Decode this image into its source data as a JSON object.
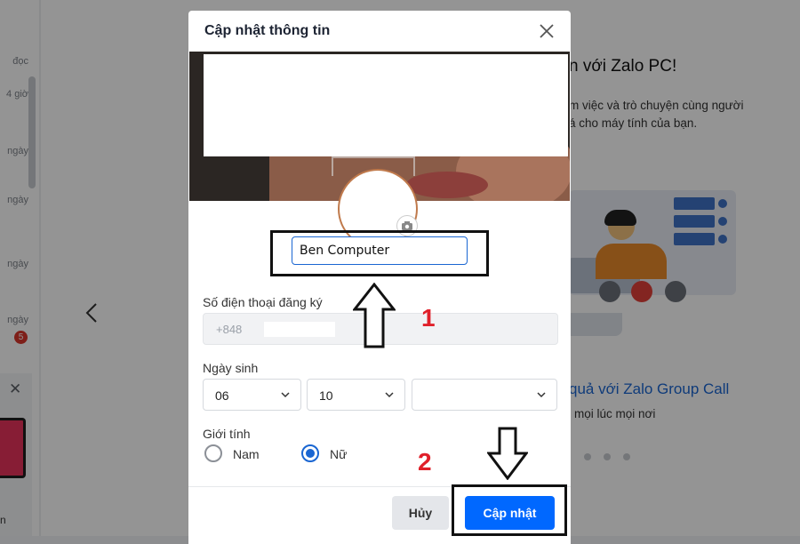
{
  "background": {
    "list_meta": [
      "đọc",
      "4 giờ",
      "ngày",
      "ngày",
      "ngày",
      "ngày"
    ],
    "unread_badge": "5",
    "welcome_title": "n với Zalo PC!",
    "welcome_desc": "m việc và trò chuyện cùng người\ná cho máy tính của bạn.",
    "feature_title": "quả với Zalo Group Call",
    "feature_desc": "mọi lúc mọi nơi",
    "notif_text": "n"
  },
  "modal": {
    "title": "Cập nhật thông tin",
    "display_name": "Ben Computer",
    "phone_label": "Số điện thoại đăng ký",
    "phone_value": "+848",
    "dob_label": "Ngày sinh",
    "dob_day": "06",
    "dob_month": "10",
    "dob_year": "",
    "gender_label": "Giới tính",
    "gender_male": "Nam",
    "gender_female": "Nữ",
    "gender_selected": "Nữ",
    "cancel_label": "Hủy",
    "update_label": "Cập nhật"
  },
  "annotations": {
    "step1": "1",
    "step2": "2"
  },
  "colors": {
    "primary": "#0068ff",
    "annotation_red": "#e0202a",
    "link_blue": "#1a66d2"
  }
}
